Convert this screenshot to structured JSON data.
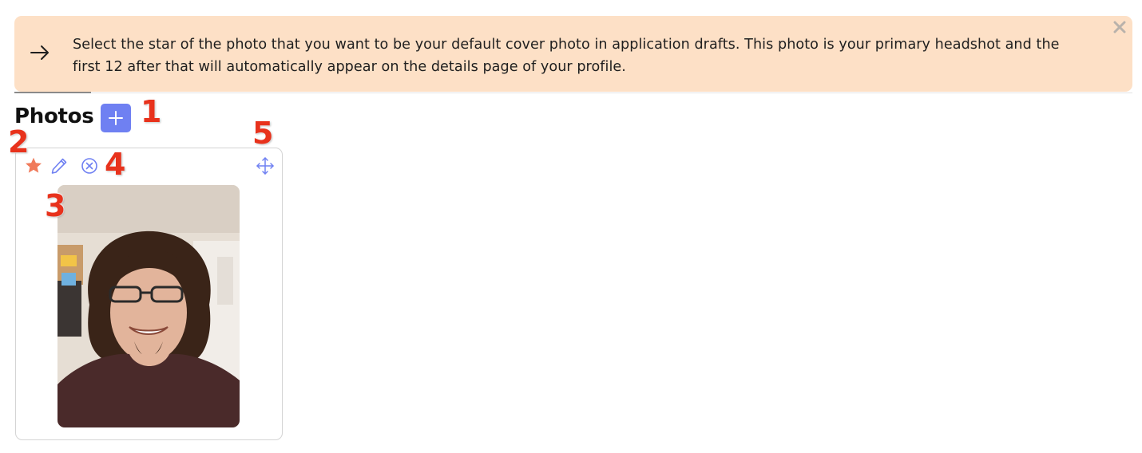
{
  "alert": {
    "text": "Select the star of the photo that you want to be your default cover photo in application drafts. This photo is your primary headshot and the first 12 after that will automatically appear on the details page of your profile.",
    "icon": "arrow-right-icon",
    "close_icon": "close-icon",
    "background": "#fde0c6"
  },
  "section": {
    "title": "Photos",
    "add_icon": "plus-icon",
    "add_color": "#6f80f2"
  },
  "photo_card": {
    "actions": {
      "star_icon": "star-icon",
      "edit_icon": "pencil-icon",
      "remove_icon": "remove-circle-icon",
      "move_icon": "move-arrows-icon"
    },
    "star_color": "#f07a5a",
    "action_color": "#6f80f2"
  },
  "callouts": [
    "1",
    "2",
    "3",
    "4",
    "5"
  ]
}
